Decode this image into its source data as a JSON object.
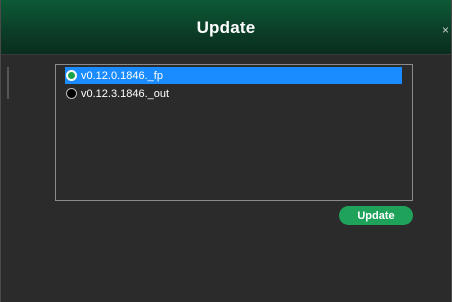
{
  "window": {
    "title": "Update",
    "close_glyph": "×"
  },
  "version_list": {
    "items": [
      {
        "label": "v0.12.0.1846._fp",
        "selected": true
      },
      {
        "label": "v0.12.3.1846._out",
        "selected": false
      }
    ]
  },
  "actions": {
    "update_label": "Update"
  },
  "colors": {
    "titlebar_accent": "#0b3f28",
    "selection": "#1a8cff",
    "button": "#1fa35b",
    "background": "#2b2b2b"
  }
}
